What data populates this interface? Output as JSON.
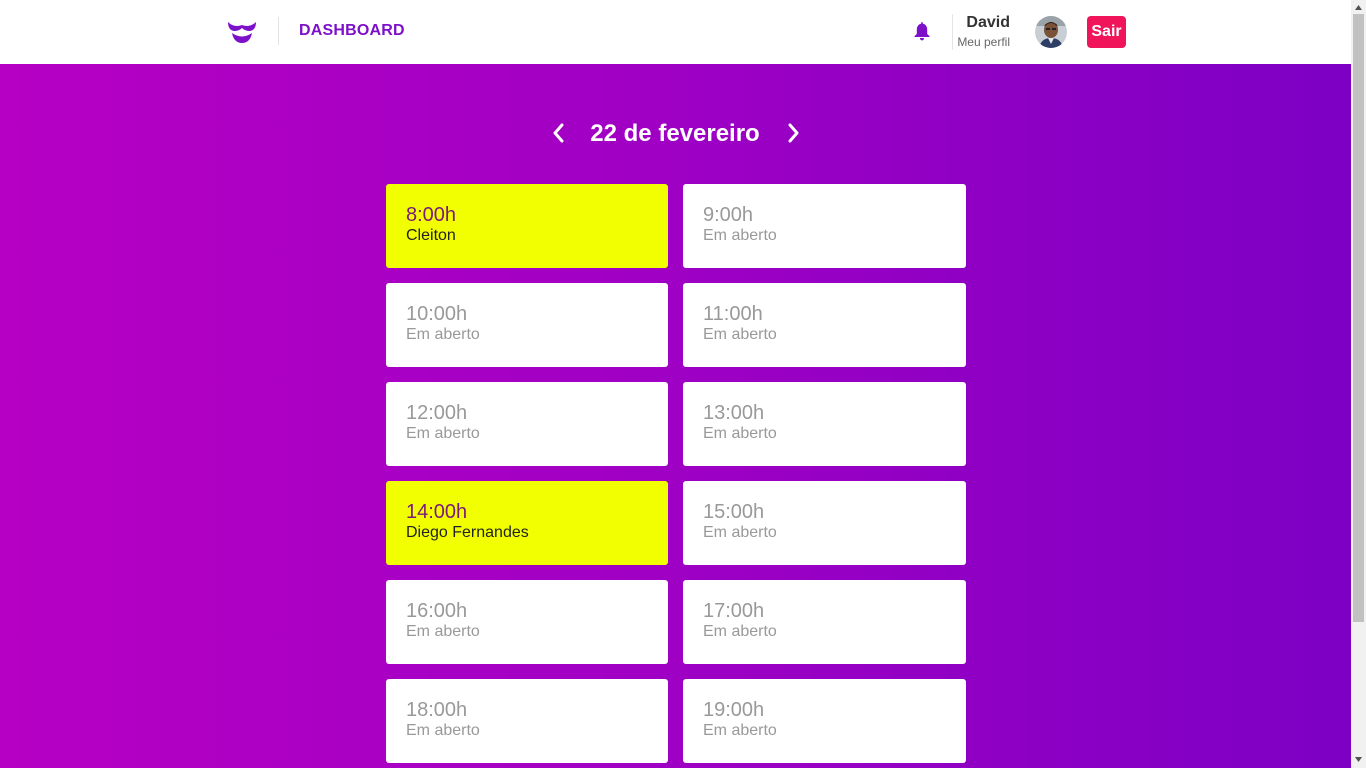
{
  "header": {
    "title": "DASHBOARD",
    "user_name": "David",
    "profile_link": "Meu perfil",
    "logout_label": "Sair",
    "icons": [
      "mustache-logo-icon",
      "bell-icon"
    ]
  },
  "date_nav": {
    "date": "22 de fevereiro",
    "prev_icon": "chevron-left-icon",
    "next_icon": "chevron-right-icon"
  },
  "colors": {
    "accent": "#7d10c9",
    "booked": "#f2ff00",
    "logout": "#f0145a",
    "gradient_start": "#b600c4",
    "gradient_end": "#7c00c4"
  },
  "slots": [
    {
      "time": "8:00h",
      "client": "Cleiton",
      "booked": true
    },
    {
      "time": "9:00h",
      "client": "Em aberto",
      "booked": false
    },
    {
      "time": "10:00h",
      "client": "Em aberto",
      "booked": false
    },
    {
      "time": "11:00h",
      "client": "Em aberto",
      "booked": false
    },
    {
      "time": "12:00h",
      "client": "Em aberto",
      "booked": false
    },
    {
      "time": "13:00h",
      "client": "Em aberto",
      "booked": false
    },
    {
      "time": "14:00h",
      "client": "Diego Fernandes",
      "booked": true
    },
    {
      "time": "15:00h",
      "client": "Em aberto",
      "booked": false
    },
    {
      "time": "16:00h",
      "client": "Em aberto",
      "booked": false
    },
    {
      "time": "17:00h",
      "client": "Em aberto",
      "booked": false
    },
    {
      "time": "18:00h",
      "client": "Em aberto",
      "booked": false
    },
    {
      "time": "19:00h",
      "client": "Em aberto",
      "booked": false
    }
  ]
}
